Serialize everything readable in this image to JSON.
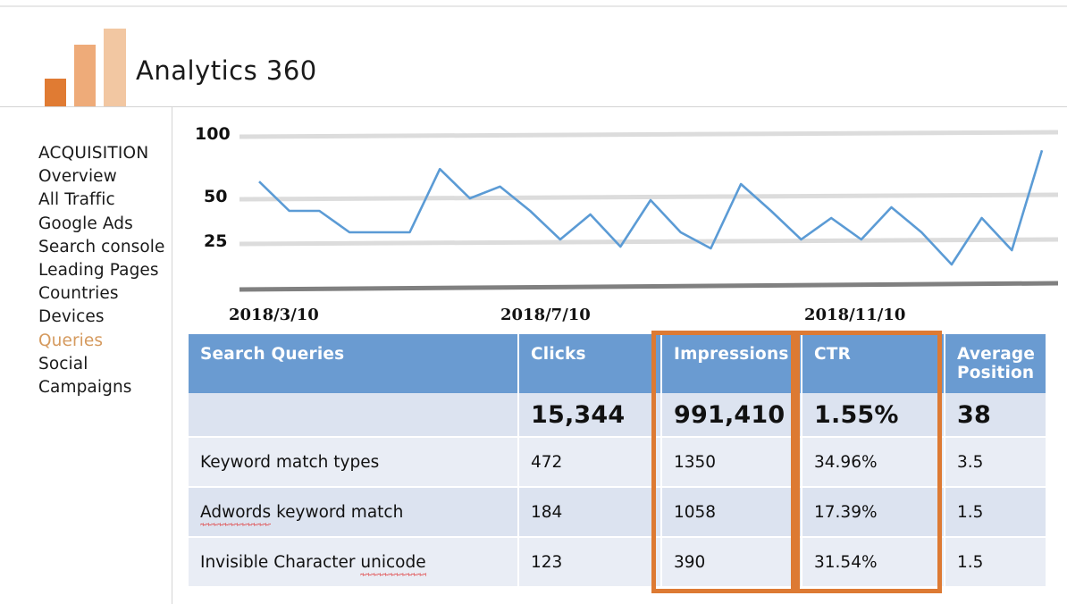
{
  "header": {
    "title": "Analytics 360",
    "logo": {
      "name": "analytics-bar-logo",
      "bar_colors": [
        "#e07b33",
        "#eeab79",
        "#f2c7a2"
      ]
    }
  },
  "sidebar": {
    "items": [
      {
        "label": "ACQUISITION",
        "active": false,
        "section": true
      },
      {
        "label": "Overview",
        "active": false,
        "section": false
      },
      {
        "label": "All Traffic",
        "active": false,
        "section": false
      },
      {
        "label": "Google Ads",
        "active": false,
        "section": false
      },
      {
        "label": "Search console",
        "active": false,
        "section": false
      },
      {
        "label": "Leading Pages",
        "active": false,
        "section": false
      },
      {
        "label": "Countries",
        "active": false,
        "section": false
      },
      {
        "label": "Devices",
        "active": false,
        "section": false
      },
      {
        "label": "Queries",
        "active": true,
        "section": false
      },
      {
        "label": "Social",
        "active": false,
        "section": false
      },
      {
        "label": "Campaigns",
        "active": false,
        "section": false
      }
    ],
    "active_color": "#d59a5e"
  },
  "chart_data": {
    "type": "line",
    "title": "",
    "xlabel": "",
    "ylabel": "",
    "grid": true,
    "legend": false,
    "line_color": "#5b9bd5",
    "gridline_color": "#dcdcdc",
    "axis_color": "#808080",
    "ytick_labels": [
      "100",
      "50",
      "25"
    ],
    "ytick_values": [
      100,
      50,
      25
    ],
    "xtick_labels": [
      "2018/3/10",
      "2018/7/10",
      "2018/11/10"
    ],
    "ylim": [
      0,
      110
    ],
    "x": [
      1,
      2,
      3,
      4,
      5,
      6,
      7,
      8,
      9,
      10,
      11,
      12,
      13,
      14,
      15,
      16,
      17,
      18,
      19,
      20,
      21,
      22,
      23,
      24,
      25,
      26,
      27
    ],
    "values": [
      62,
      42,
      42,
      30,
      30,
      30,
      72,
      49,
      58,
      42,
      26,
      40,
      22,
      48,
      30,
      21,
      60,
      42,
      26,
      38,
      26,
      44,
      30,
      12,
      38,
      20,
      87
    ]
  },
  "table": {
    "columns": [
      "Search Queries",
      "Clicks",
      "Impressions",
      "CTR",
      "Average Position"
    ],
    "summary_row": [
      "",
      "15,344",
      "991,410",
      "1.55%",
      "38"
    ],
    "rows": [
      {
        "query": "Keyword match types",
        "query_misspelled": "",
        "clicks": "472",
        "impressions": "1350",
        "ctr": "34.96%",
        "avg_position": "3.5"
      },
      {
        "query": "",
        "query_prefix": "",
        "query_misspelled": "Adwords",
        "query_suffix": " keyword match",
        "clicks": "184",
        "impressions": "1058",
        "ctr": "17.39%",
        "avg_position": "1.5"
      },
      {
        "query": "",
        "query_prefix": "Invisible Character ",
        "query_misspelled": "unicode",
        "query_suffix": "",
        "clicks": "123",
        "impressions": "390",
        "ctr": "31.54%",
        "avg_position": "1.5"
      }
    ],
    "header_bg": "#6a9bd1",
    "row_bg_odd": "#dce3f0",
    "row_bg_even": "#e9edf5"
  },
  "highlights": {
    "color": "#dd7a33",
    "boxes": [
      {
        "name": "impressions-column-highlight",
        "column": "Impressions"
      },
      {
        "name": "ctr-column-highlight",
        "column": "CTR"
      }
    ]
  }
}
